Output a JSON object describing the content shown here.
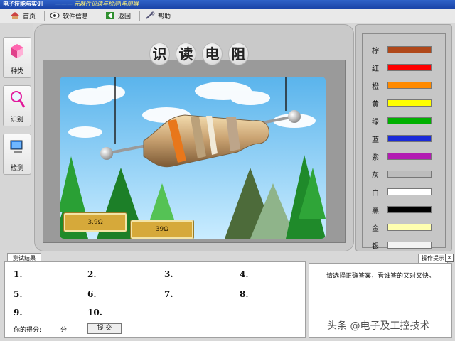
{
  "window": {
    "app_title": "电子技能与实训",
    "separator": "———",
    "subtitle": "元器件识读与检测\\电阻器"
  },
  "toolbar": {
    "home_label": "首页",
    "info_label": "软件信息",
    "back_label": "返回",
    "help_label": "帮助"
  },
  "sidebar": {
    "items": [
      {
        "label": "种类",
        "icon": "box-icon"
      },
      {
        "label": "识别",
        "icon": "magnifier-icon"
      },
      {
        "label": "检测",
        "icon": "computer-icon"
      }
    ]
  },
  "main": {
    "title_chars": [
      "识",
      "读",
      "电",
      "阻"
    ],
    "answers": [
      {
        "label": "3.9Ω"
      },
      {
        "label": "39Ω"
      }
    ]
  },
  "color_panel": {
    "items": [
      {
        "name": "棕",
        "color": "#b0481a"
      },
      {
        "name": "红",
        "color": "#ff0000"
      },
      {
        "name": "橙",
        "color": "#ff8a00"
      },
      {
        "name": "黄",
        "color": "#ffff00"
      },
      {
        "name": "绿",
        "color": "#00b000"
      },
      {
        "name": "蓝",
        "color": "#1a2ad8"
      },
      {
        "name": "紫",
        "color": "#b21cb2"
      },
      {
        "name": "灰",
        "color": "#bcbcbc"
      },
      {
        "name": "白",
        "color": "#ffffff"
      },
      {
        "name": "黑",
        "color": "#000000"
      },
      {
        "name": "金",
        "color": "#ffffb0"
      },
      {
        "name": "银",
        "color": "#f4f4f4"
      }
    ]
  },
  "results": {
    "tab_label": "测试结果",
    "questions": [
      "1.",
      "2.",
      "3.",
      "4.",
      "5.",
      "6.",
      "7.",
      "8.",
      "9.",
      "10."
    ],
    "score_label": "你的得分:",
    "score_unit": "分",
    "submit_label": "提  交"
  },
  "hint": {
    "tab_label": "操作提示",
    "close_label": "×",
    "message": "请选择正确答案，看谁答的又对又快。"
  },
  "watermark": "头条 @电子及工控技术"
}
